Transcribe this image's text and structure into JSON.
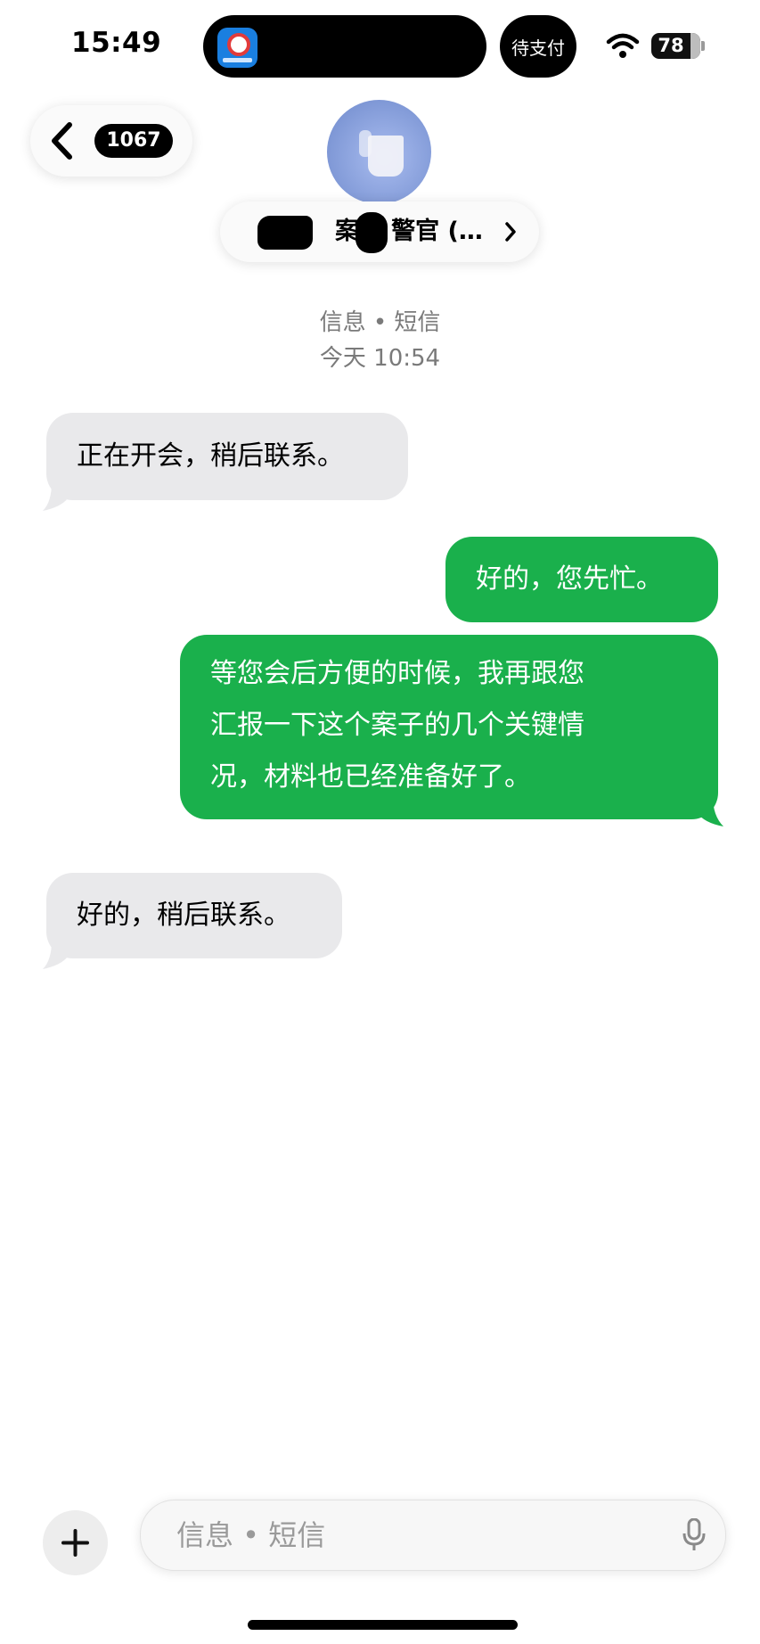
{
  "status_bar": {
    "time": "15:49",
    "pending_label": "待支付",
    "battery_level": "78",
    "battery_fraction": 0.78
  },
  "header": {
    "back_count": "1067",
    "contact_name": "案 警官 (…",
    "contact_name_parts": [
      "案",
      "警官 (…"
    ]
  },
  "conversation": {
    "service_label": "信息 • 短信",
    "timestamp": "今天 10:54",
    "messages": [
      {
        "direction": "incoming",
        "text": "正在开会，稍后联系。"
      },
      {
        "direction": "outgoing",
        "text": "好的，您先忙。"
      },
      {
        "direction": "outgoing",
        "text": "等您会后方便的时候，我再跟您汇报一下这个案子的几个关键情况，材料也已经准备好了。",
        "lines": [
          "等您会后方便的时候，我再跟您",
          "汇报一下这个案子的几个关键情",
          "况，材料也已经准备好了。"
        ]
      },
      {
        "direction": "incoming",
        "text": "好的，稍后联系。"
      }
    ]
  },
  "input_bar": {
    "placeholder": "信息 • 短信"
  },
  "colors": {
    "outgoing_bubble": "#1ab04c",
    "incoming_bubble": "#e9e9eb"
  },
  "icons": [
    "wifi-icon",
    "back-chevron-icon",
    "chevron-right-icon",
    "plus-icon",
    "microphone-icon",
    "app-icon"
  ]
}
